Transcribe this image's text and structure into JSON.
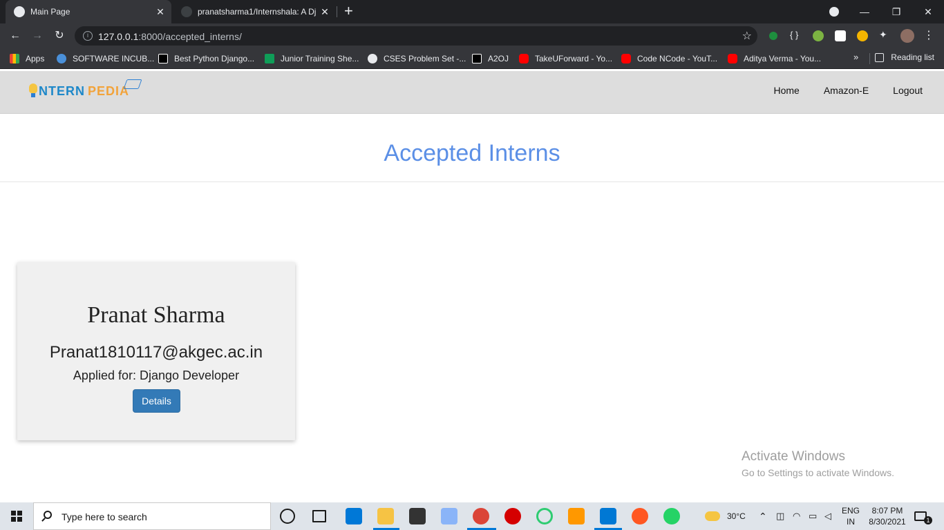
{
  "browser": {
    "tabs": [
      {
        "title": "Main Page",
        "active": true
      },
      {
        "title": "pranatsharma1/Internshala: A Dj",
        "active": false
      }
    ],
    "url_host": "127.0.0.1",
    "url_rest": ":8000/accepted_interns/",
    "bookmarks": [
      "Apps",
      "SOFTWARE INCUB...",
      "Best Python Django...",
      "Junior Training She...",
      "CSES Problem Set -...",
      "A2OJ",
      "TakeUForward - Yo...",
      "Code NCode - YouT...",
      "Aditya Verma - You..."
    ],
    "reading_list": "Reading list",
    "overflow": "»"
  },
  "site": {
    "logo_word1": "NTERN",
    "logo_word2": "PEDIA",
    "nav": [
      "Home",
      "Amazon-E",
      "Logout"
    ],
    "heading": "Accepted Interns"
  },
  "intern": {
    "name": "Pranat Sharma",
    "email": "Pranat1810117@akgec.ac.in",
    "applied": "Applied for: Django Developer",
    "button": "Details"
  },
  "watermark": {
    "line1": "Activate Windows",
    "line2": "Go to Settings to activate Windows."
  },
  "taskbar": {
    "search_placeholder": "Type here to search",
    "weather": "30°C",
    "lang1": "ENG",
    "lang2": "IN",
    "time": "8:07 PM",
    "date": "8/30/2021",
    "notifications": "1"
  }
}
